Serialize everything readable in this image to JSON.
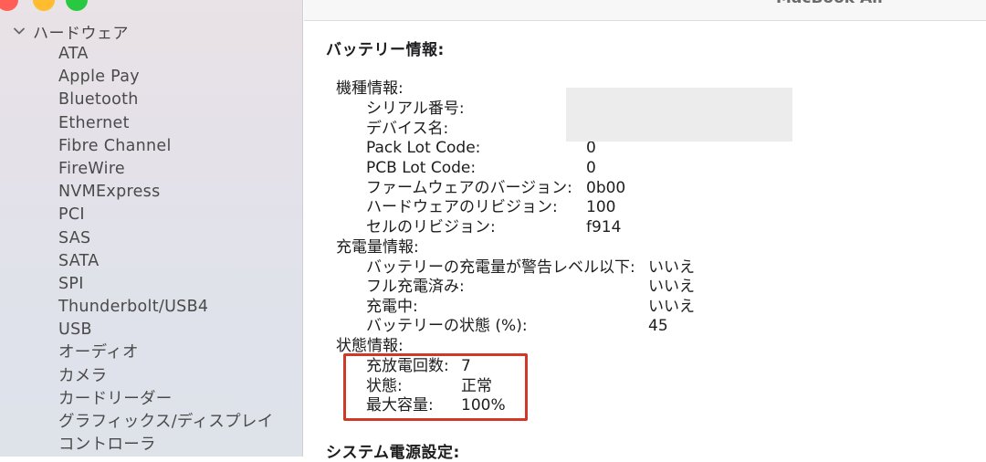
{
  "window": {
    "title": "MacBook Air"
  },
  "sidebar": {
    "section_label": "ハードウェア",
    "items": [
      "ATA",
      "Apple Pay",
      "Bluetooth",
      "Ethernet",
      "Fibre Channel",
      "FireWire",
      "NVMExpress",
      "PCI",
      "SAS",
      "SATA",
      "SPI",
      "Thunderbolt/USB4",
      "USB",
      "オーディオ",
      "カメラ",
      "カードリーダー",
      "グラフィックス/ディスプレイ",
      "コントローラ"
    ]
  },
  "battery": {
    "title": "バッテリー情報:",
    "model_info": {
      "label": "機種情報:",
      "serial_label": "シリアル番号:",
      "device_label": "デバイス名:",
      "pack_lot_label": "Pack Lot Code:",
      "pack_lot_value": "0",
      "pcb_lot_label": "PCB Lot Code:",
      "pcb_lot_value": "0",
      "firmware_label": "ファームウェアのバージョン:",
      "firmware_value": "0b00",
      "hardware_label": "ハードウェアのリビジョン:",
      "hardware_value": "100",
      "cell_label": "セルのリビジョン:",
      "cell_value": "f914"
    },
    "charge_info": {
      "label": "充電量情報:",
      "warning_label": "バッテリーの充電量が警告レベル以下:",
      "warning_value": "いいえ",
      "full_label": "フル充電済み:",
      "full_value": "いいえ",
      "charging_label": "充電中:",
      "charging_value": "いいえ",
      "state_label": "バッテリーの状態 (%):",
      "state_value": "45"
    },
    "health_info": {
      "label": "状態情報:",
      "cycle_label": "充放電回数:",
      "cycle_value": "7",
      "condition_label": "状態:",
      "condition_value": "正常",
      "capacity_label": "最大容量:",
      "capacity_value": "100%"
    }
  },
  "power": {
    "title": "システム電源設定:"
  },
  "colors": {
    "highlight_border": "#cf3a28",
    "redaction": "#ececec",
    "sidebar_text": "#4a4a4a"
  }
}
